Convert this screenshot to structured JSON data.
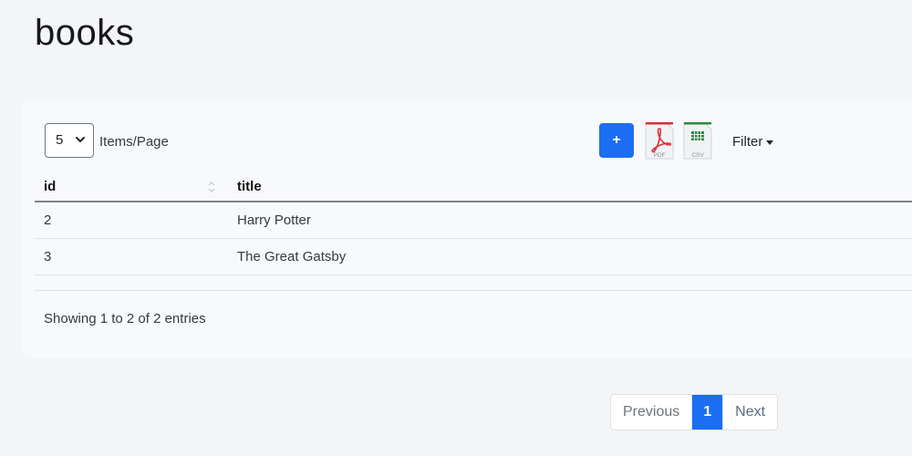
{
  "page": {
    "title": "books"
  },
  "toolbar": {
    "page_size_value": "5",
    "items_label": "Items/Page",
    "add_label": "+",
    "pdf_label": "PDF",
    "csv_label": "CSV",
    "filter_label": "Filter"
  },
  "table": {
    "columns": [
      "id",
      "title"
    ],
    "rows": [
      {
        "id": "2",
        "title": "Harry Potter"
      },
      {
        "id": "3",
        "title": "The Great Gatsby"
      }
    ]
  },
  "footer": {
    "entries_info": "Showing 1 to 2 of 2 entries"
  },
  "pagination": {
    "previous": "Previous",
    "current": "1",
    "next": "Next"
  },
  "colors": {
    "primary": "#1b6ef3",
    "pdf_red": "#d9303a",
    "csv_green": "#2a8a3e",
    "background": "#f4f5f7",
    "card": "#f7f9fc"
  },
  "icons": {
    "chevron": "chevron-down-icon",
    "sort": "sort-icon",
    "pdf": "pdf-file-icon",
    "csv": "csv-file-icon",
    "caret": "caret-down-icon"
  }
}
